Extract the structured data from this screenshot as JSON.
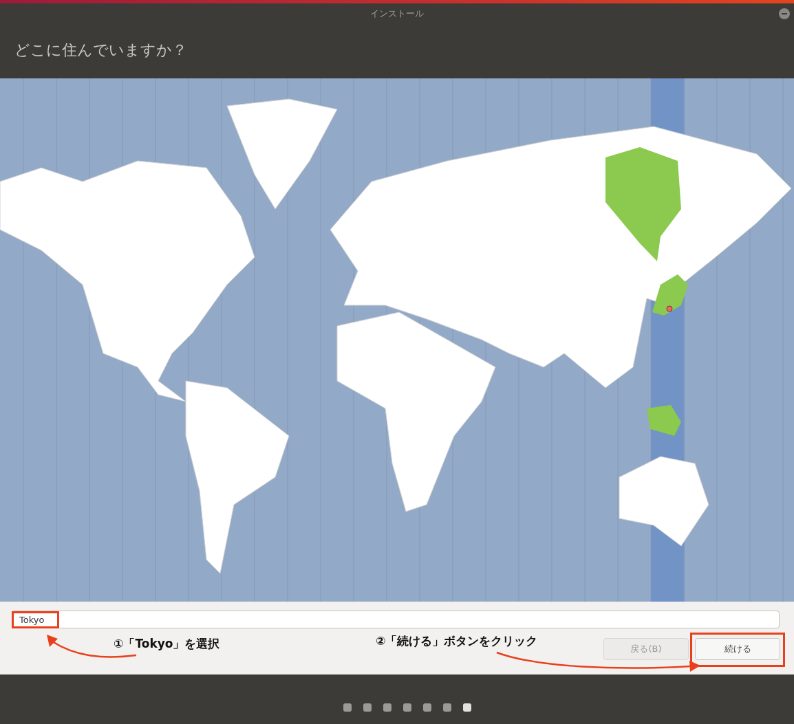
{
  "window": {
    "title": "インストール"
  },
  "heading": "どこに住んでいますか？",
  "location_field": {
    "value": "Tokyo"
  },
  "buttons": [
    {
      "label": "戻る(B)",
      "disabled": true
    },
    {
      "label": "続ける",
      "disabled": false
    }
  ],
  "annotations": [
    {
      "text": "①「Tokyo」を選択"
    },
    {
      "text": "②「続ける」ボタンをクリック"
    }
  ],
  "progress_dots": [
    {
      "selected": false
    },
    {
      "selected": false
    },
    {
      "selected": false
    },
    {
      "selected": false
    },
    {
      "selected": false
    },
    {
      "selected": false
    },
    {
      "selected": true
    }
  ]
}
